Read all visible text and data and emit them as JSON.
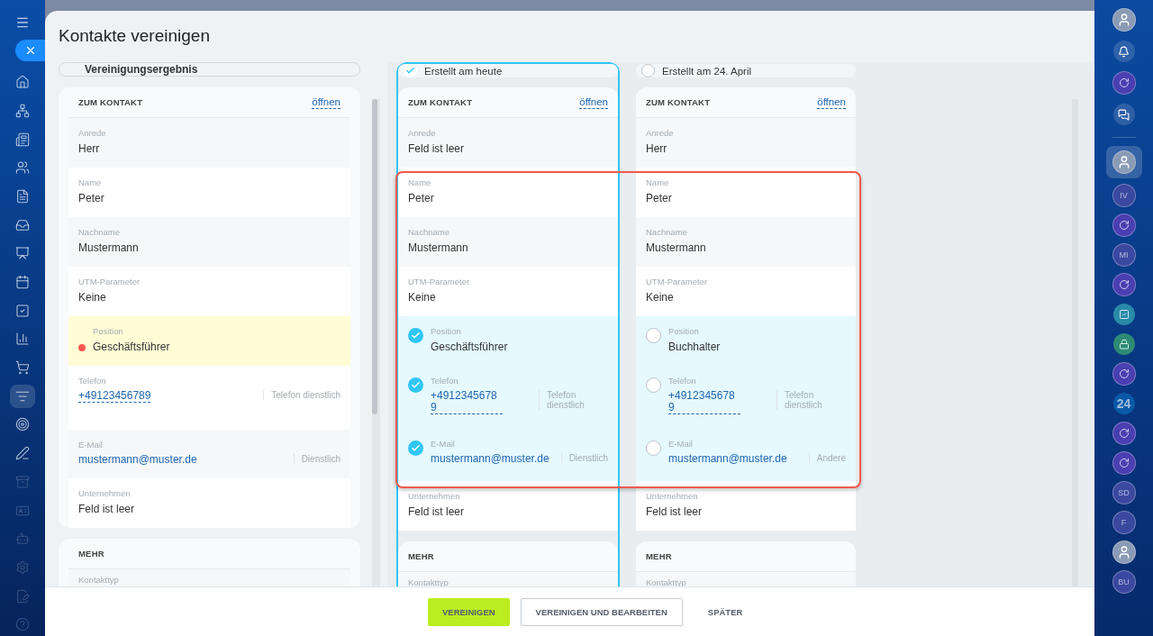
{
  "left_nav": {
    "items": [
      {
        "kind": "home",
        "selected": false
      },
      {
        "kind": "network",
        "selected": false
      },
      {
        "kind": "news",
        "selected": false
      },
      {
        "kind": "users",
        "selected": false
      },
      {
        "kind": "document",
        "selected": false
      },
      {
        "kind": "inbox",
        "selected": false
      },
      {
        "kind": "board",
        "selected": false
      },
      {
        "kind": "calendar",
        "selected": false
      },
      {
        "kind": "task",
        "selected": false
      },
      {
        "kind": "chart",
        "selected": false
      },
      {
        "kind": "cart",
        "selected": false
      },
      {
        "kind": "funnel",
        "selected": true
      },
      {
        "kind": "target",
        "selected": false
      },
      {
        "kind": "pen",
        "selected": false
      },
      {
        "kind": "archive",
        "selected": false
      },
      {
        "kind": "card",
        "selected": false
      },
      {
        "kind": "bot",
        "selected": false
      },
      {
        "kind": "settings",
        "selected": false
      },
      {
        "kind": "file",
        "selected": false
      },
      {
        "kind": "help",
        "selected": false
      }
    ]
  },
  "dialog": {
    "title": "Kontakte vereinigen",
    "result": {
      "label": "Vereinigungsergebnis",
      "sections": [
        {
          "heading": "ZUM KONTAKT",
          "link": "öffnen",
          "fields": [
            {
              "label": "Anrede",
              "value": "Herr",
              "kind": "text",
              "conflict": false
            },
            {
              "label": "Name",
              "value": "Peter",
              "kind": "text",
              "conflict": false
            },
            {
              "label": "Nachname",
              "value": "Mustermann",
              "kind": "text",
              "conflict": false
            },
            {
              "label": "UTM-Parameter",
              "value": "Keine",
              "kind": "text",
              "conflict": false
            },
            {
              "label": "Position",
              "value": "Geschäftsführer",
              "kind": "text",
              "conflict": true
            },
            {
              "label": "Telefon",
              "value": "+49123456789",
              "kind": "phone",
              "type": "Telefon dienstlich",
              "conflict": false
            },
            {
              "label": "E-Mail",
              "value": "mustermann@muster.de",
              "kind": "email",
              "type": "Dienstlich",
              "conflict": false
            },
            {
              "label": "Unternehmen",
              "value": "Feld ist leer",
              "kind": "text",
              "conflict": false
            }
          ]
        },
        {
          "heading": "MEHR",
          "fields": [
            {
              "label": "Kontakttyp",
              "kind": "text",
              "conflict": false
            }
          ]
        }
      ]
    },
    "candidates": [
      {
        "label": "Erstellt am heute",
        "selected": true,
        "sections": [
          {
            "heading": "ZUM KONTAKT",
            "link": "öffnen",
            "fields": [
              {
                "label": "Anrede",
                "value": "Feld ist leer",
                "kind": "text"
              },
              {
                "label": "Name",
                "value": "Peter",
                "kind": "text"
              },
              {
                "label": "Nachname",
                "value": "Mustermann",
                "kind": "text"
              },
              {
                "label": "UTM-Parameter",
                "value": "Keine",
                "kind": "text"
              },
              {
                "label": "Position",
                "value": "Geschäftsführer",
                "kind": "text",
                "checked": true
              },
              {
                "label": "Telefon",
                "value": "+49123456789",
                "kind": "phone",
                "type": "Telefon dienstlich",
                "checked": true
              },
              {
                "label": "E-Mail",
                "value": "mustermann@muster.de",
                "kind": "email",
                "type": "Dienstlich",
                "checked": true
              },
              {
                "label": "Unternehmen",
                "value": "Feld ist leer",
                "kind": "text"
              }
            ]
          },
          {
            "heading": "MEHR",
            "fields": [
              {
                "label": "Kontakttyp",
                "kind": "text"
              }
            ]
          }
        ]
      },
      {
        "label": "Erstellt am 24. April",
        "selected": false,
        "sections": [
          {
            "heading": "ZUM KONTAKT",
            "link": "öffnen",
            "fields": [
              {
                "label": "Anrede",
                "value": "Herr",
                "kind": "text"
              },
              {
                "label": "Name",
                "value": "Peter",
                "kind": "text"
              },
              {
                "label": "Nachname",
                "value": "Mustermann",
                "kind": "text"
              },
              {
                "label": "UTM-Parameter",
                "value": "Keine",
                "kind": "text"
              },
              {
                "label": "Position",
                "value": "Buchhalter",
                "kind": "text",
                "checked": false
              },
              {
                "label": "Telefon",
                "value": "+49123456789",
                "kind": "phone",
                "type": "Telefon dienstlich",
                "checked": false
              },
              {
                "label": "E-Mail",
                "value": "mustermann@muster.de",
                "kind": "email",
                "type": "Andere",
                "checked": false
              },
              {
                "label": "Unternehmen",
                "value": "Feld ist leer",
                "kind": "text"
              }
            ]
          },
          {
            "heading": "MEHR",
            "fields": [
              {
                "label": "Kontakttyp",
                "kind": "text"
              }
            ]
          }
        ]
      }
    ],
    "buttons": [
      {
        "label": "VEREINIGEN",
        "kind": "primary"
      },
      {
        "label": "VEREINIGEN UND BEARBEITEN",
        "kind": "secondary"
      },
      {
        "label": "SPÄTER",
        "kind": "link"
      }
    ]
  },
  "right_bar": {
    "items": [
      {
        "kind": "avatar",
        "selected": false
      },
      {
        "kind": "bell",
        "selected": false
      },
      {
        "kind": "spiral",
        "selected": false
      },
      {
        "kind": "chat",
        "selected": false
      },
      {
        "kind": "divider"
      },
      {
        "kind": "avatar",
        "selected": true
      },
      {
        "kind": "initials",
        "text": "IV",
        "selected": false
      },
      {
        "kind": "spiral",
        "selected": false
      },
      {
        "kind": "initials",
        "text": "MI",
        "selected": false
      },
      {
        "kind": "spiral",
        "selected": false
      },
      {
        "kind": "task",
        "selected": false
      },
      {
        "kind": "lock",
        "selected": false
      },
      {
        "kind": "spiral",
        "selected": false
      },
      {
        "kind": "brand",
        "text": "24",
        "selected": false
      },
      {
        "kind": "spiral",
        "selected": false
      },
      {
        "kind": "spiral",
        "selected": false
      },
      {
        "kind": "initials",
        "text": "SD",
        "selected": false
      },
      {
        "kind": "initials",
        "text": "F",
        "selected": false
      },
      {
        "kind": "avatar",
        "selected": false
      },
      {
        "kind": "initials",
        "text": "BU",
        "selected": false
      }
    ]
  }
}
